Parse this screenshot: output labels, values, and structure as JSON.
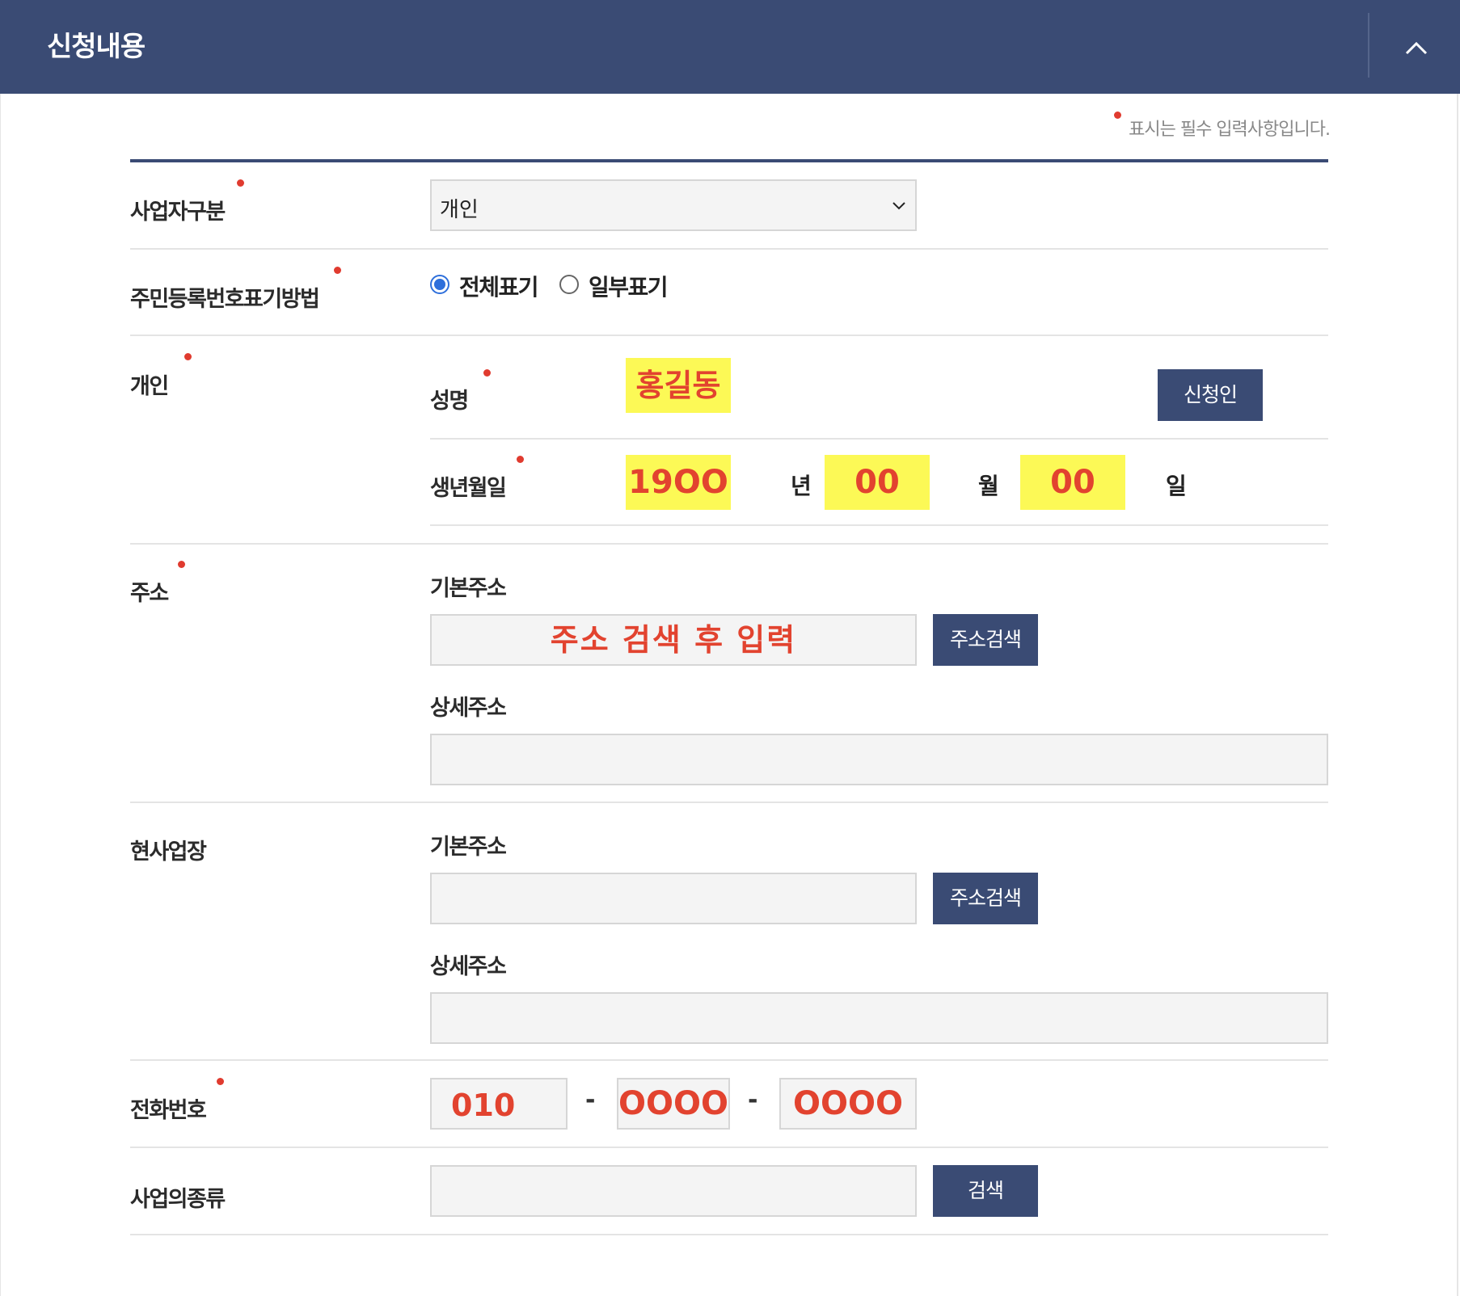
{
  "header": {
    "title": "신청내용",
    "toggle_icon": "chevron-up-icon"
  },
  "required_note": "표시는 필수 입력사항입니다.",
  "business_type": {
    "label": "사업자구분",
    "selected": "개인"
  },
  "id_display": {
    "label": "주민등록번호표기방법",
    "options": [
      {
        "label": "전체표기",
        "checked": true
      },
      {
        "label": "일부표기",
        "checked": false
      }
    ]
  },
  "individual": {
    "label": "개인",
    "name_label": "성명",
    "name_value": "홍길동",
    "applicant_button": "신청인",
    "birth_label": "생년월일",
    "birth_year": "19OO",
    "year_unit": "년",
    "birth_month": "00",
    "month_unit": "월",
    "birth_day": "00",
    "day_unit": "일"
  },
  "address": {
    "label": "주소",
    "basic_label": "기본주소",
    "basic_value": "주소 검색 후 입력",
    "search_button": "주소검색",
    "detail_label": "상세주소"
  },
  "workplace": {
    "label": "현사업장",
    "basic_label": "기본주소",
    "search_button": "주소검색",
    "detail_label": "상세주소"
  },
  "phone": {
    "label": "전화번호",
    "part1": "010",
    "separator": "-",
    "part2": "OOOO",
    "part3": "OOOO"
  },
  "business_kind": {
    "label": "사업의종류",
    "search_button": "검색"
  }
}
